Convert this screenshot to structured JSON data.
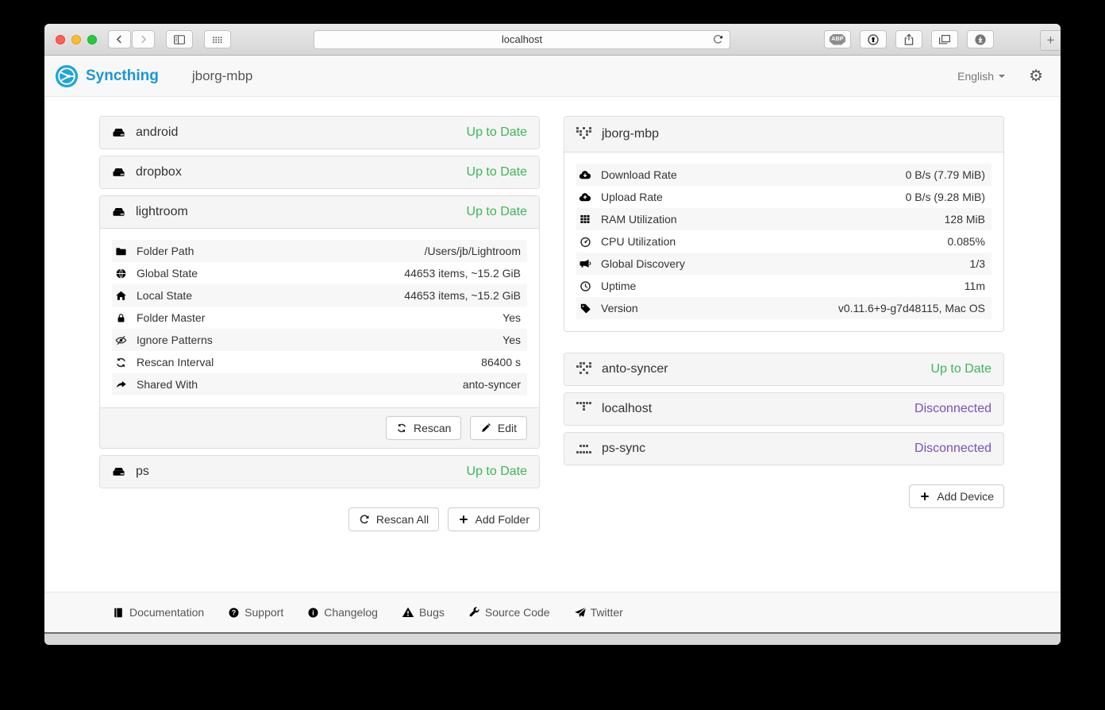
{
  "browser": {
    "url": "localhost",
    "new_tab_label": "+",
    "icons": [
      "back",
      "forward",
      "sidebar",
      "top-sites-grid",
      "reload",
      "adblock",
      "onepassword",
      "share",
      "tab-overview",
      "downloads"
    ]
  },
  "header": {
    "brand": "Syncthing",
    "title": "jborg-mbp",
    "language": "English"
  },
  "colors": {
    "success": "#3db657",
    "disconnected": "#7a4fbf",
    "brand_blue": "#1a97d4"
  },
  "folders": {
    "0": {
      "name": "android",
      "status": "Up to Date"
    },
    "1": {
      "name": "dropbox",
      "status": "Up to Date"
    },
    "2": {
      "name": "lightroom",
      "status": "Up to Date",
      "details": {
        "0": {
          "icon": "folder-icon",
          "label": "Folder Path",
          "value": "/Users/jb/Lightroom"
        },
        "1": {
          "icon": "globe-icon",
          "label": "Global State",
          "value": "44653 items, ~15.2 GiB"
        },
        "2": {
          "icon": "home-icon",
          "label": "Local State",
          "value": "44653 items, ~15.2 GiB"
        },
        "3": {
          "icon": "lock-icon",
          "label": "Folder Master",
          "value": "Yes"
        },
        "4": {
          "icon": "eye-slash-icon",
          "label": "Ignore Patterns",
          "value": "Yes"
        },
        "5": {
          "icon": "refresh-icon",
          "label": "Rescan Interval",
          "value": "86400 s"
        },
        "6": {
          "icon": "share-icon",
          "label": "Shared With",
          "value": "anto-syncer"
        }
      },
      "actions": {
        "rescan": "Rescan",
        "edit": "Edit"
      }
    },
    "3": {
      "name": "ps",
      "status": "Up to Date"
    }
  },
  "folder_actions": {
    "rescan_all": "Rescan All",
    "add_folder": "Add Folder"
  },
  "device": {
    "name": "jborg-mbp",
    "identicon": [
      "10101",
      "11011",
      "01010",
      "00100",
      "00000"
    ],
    "details": {
      "0": {
        "icon": "cloud-download-icon",
        "label": "Download Rate",
        "value": "0 B/s (7.79 MiB)"
      },
      "1": {
        "icon": "cloud-upload-icon",
        "label": "Upload Rate",
        "value": "0 B/s (9.28 MiB)"
      },
      "2": {
        "icon": "th-grid-icon",
        "label": "RAM Utilization",
        "value": "128 MiB"
      },
      "3": {
        "icon": "gauge-icon",
        "label": "CPU Utilization",
        "value": "0.085%"
      },
      "4": {
        "icon": "bullhorn-icon",
        "label": "Global Discovery",
        "value": "1/3"
      },
      "5": {
        "icon": "clock-icon",
        "label": "Uptime",
        "value": "11m"
      },
      "6": {
        "icon": "tag-icon",
        "label": "Version",
        "value": "v0.11.6+9-g7d48115, Mac OS"
      }
    }
  },
  "devices": {
    "0": {
      "name": "anto-syncer",
      "status": "Up to Date",
      "identicon": [
        "01101",
        "11011",
        "00100",
        "01010",
        "00000"
      ]
    },
    "1": {
      "name": "localhost",
      "status": "Disconnected",
      "identicon": [
        "11111",
        "00100",
        "00100",
        "00000",
        "00000"
      ]
    },
    "2": {
      "name": "ps-sync",
      "status": "Disconnected",
      "identicon": [
        "00000",
        "01110",
        "00000",
        "11111",
        "00000"
      ]
    }
  },
  "device_actions": {
    "add_device": "Add Device"
  },
  "footer": {
    "links": {
      "0": {
        "icon": "book-icon",
        "label": "Documentation"
      },
      "1": {
        "icon": "question-circle-icon",
        "label": "Support"
      },
      "2": {
        "icon": "info-circle-icon",
        "label": "Changelog"
      },
      "3": {
        "icon": "warning-icon",
        "label": "Bugs"
      },
      "4": {
        "icon": "wrench-icon",
        "label": "Source Code"
      },
      "5": {
        "icon": "send-icon",
        "label": "Twitter"
      }
    }
  }
}
